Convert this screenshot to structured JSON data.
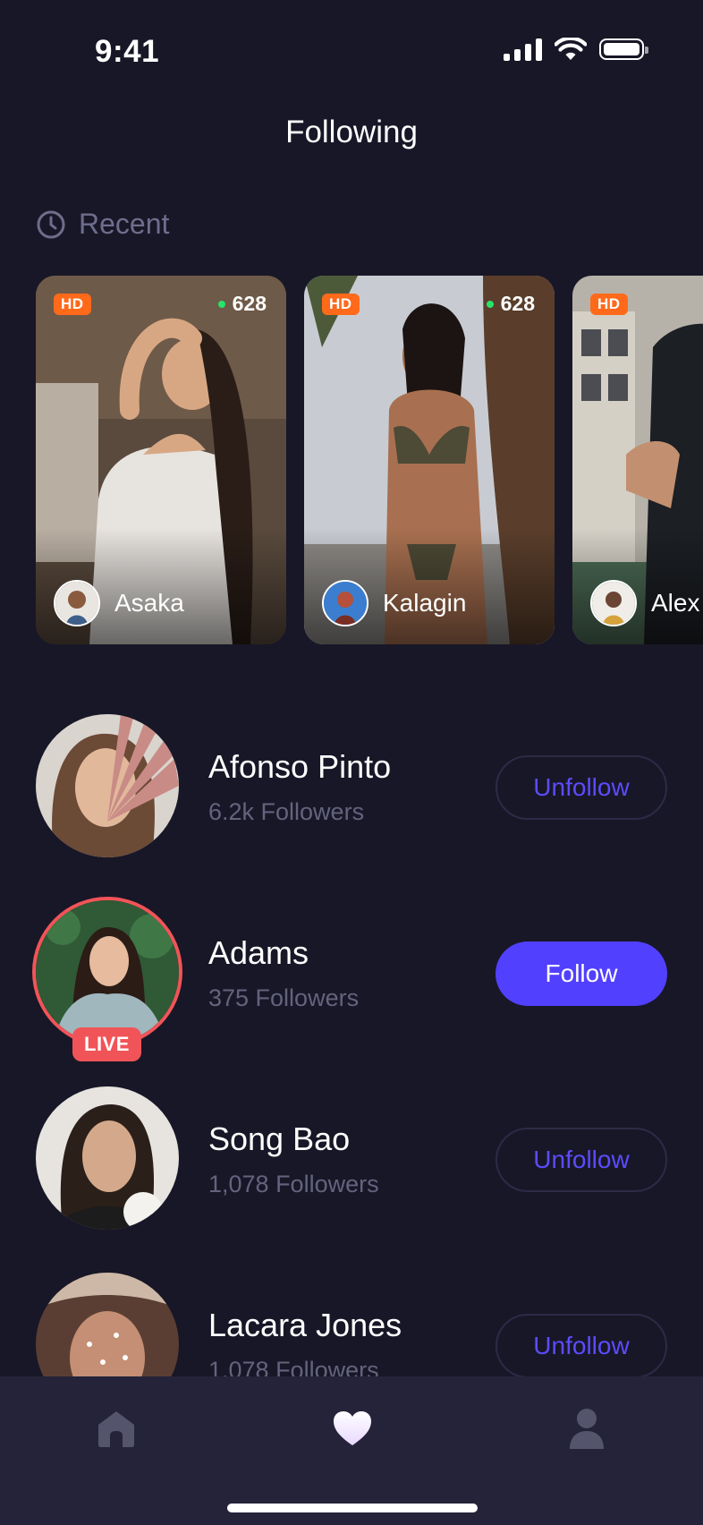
{
  "status_bar": {
    "time": "9:41"
  },
  "header": {
    "title": "Following"
  },
  "recent": {
    "title": "Recent",
    "cards": [
      {
        "badge": "HD",
        "viewers": "628",
        "name": "Asaka"
      },
      {
        "badge": "HD",
        "viewers": "628",
        "name": "Kalagin"
      },
      {
        "badge": "HD",
        "viewers": "",
        "name": "Alex"
      }
    ]
  },
  "following": [
    {
      "name": "Afonso Pinto",
      "followers": "6.2k Followers",
      "button": "Unfollow",
      "live": false
    },
    {
      "name": "Adams",
      "followers": "375 Followers",
      "button": "Follow",
      "live": true,
      "live_label": "LIVE"
    },
    {
      "name": "Song Bao",
      "followers": "1,078 Followers",
      "button": "Unfollow",
      "live": false
    },
    {
      "name": "Lacara Jones",
      "followers": "1,078 Followers",
      "button": "Unfollow",
      "live": false
    }
  ],
  "tab_bar": {
    "items": [
      "home-icon",
      "heart-icon",
      "profile-icon"
    ],
    "active": "heart-icon"
  },
  "colors": {
    "background": "#181727",
    "accent": "#5240ff",
    "live": "#f15458",
    "hd_badge": "#ff6a1a",
    "muted": "#64637e",
    "tab_bar": "#24233a"
  }
}
